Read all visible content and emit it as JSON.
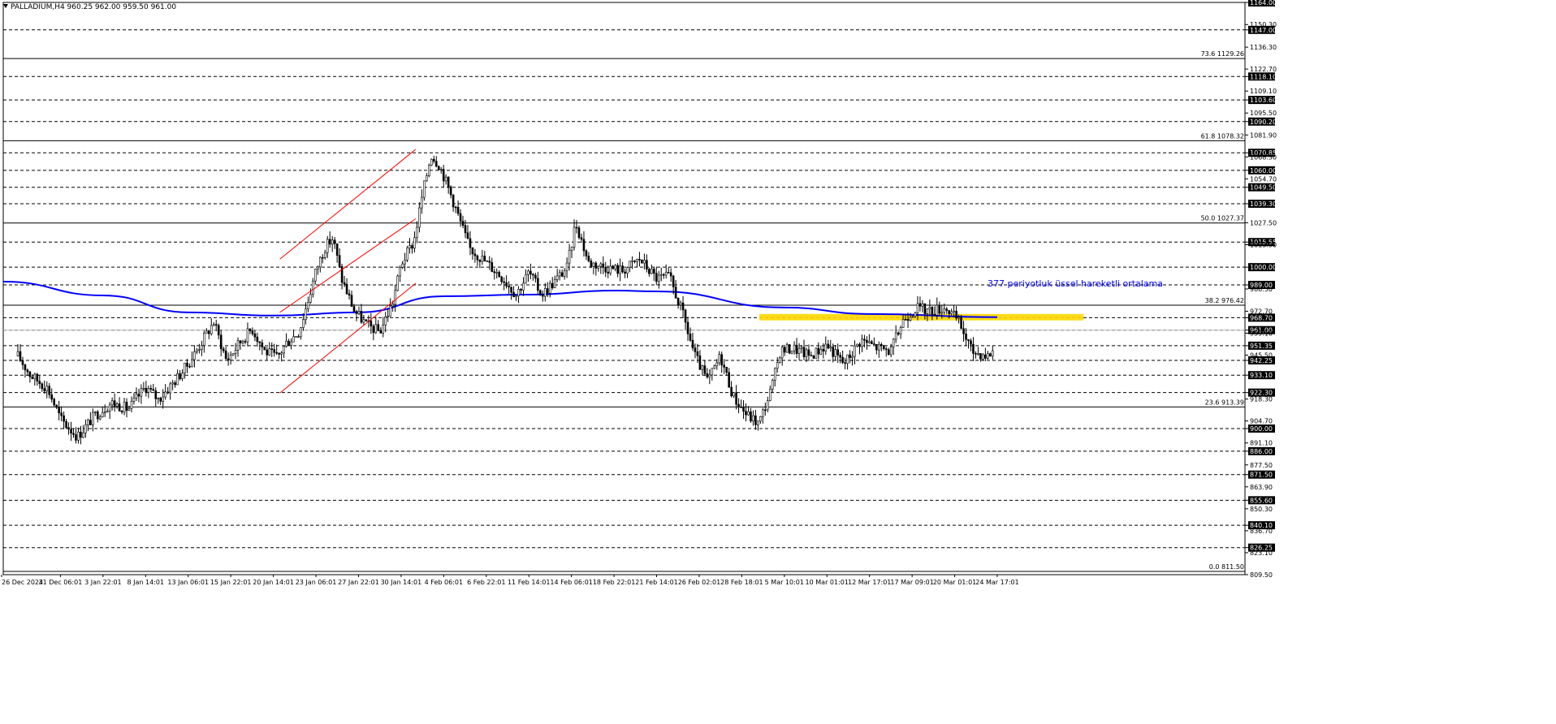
{
  "header": {
    "symbol_line": "PALLADIUM,H4  960.25 962.00 959.50 961.00"
  },
  "annotation": {
    "ema_label": "377 periyotluk üssel hareketli ortalama"
  },
  "colors": {
    "background": "#ffffff",
    "candle": "#000000",
    "ema": "#0000ff",
    "channel": "#ff0000",
    "zone": "#ffd700",
    "grid": "#000000"
  },
  "chart_data": {
    "type": "candlestick",
    "title": "PALLADIUM,H4",
    "ylim": [
      809.5,
      1164.0
    ],
    "x_ticks": [
      "26 Dec 2024",
      "31 Dec 06:01",
      "3 Jan 22:01",
      "8 Jan 14:01",
      "13 Jan 06:01",
      "15 Jan 22:01",
      "20 Jan 14:01",
      "23 Jan 06:01",
      "27 Jan 22:01",
      "30 Jan 14:01",
      "4 Feb 06:01",
      "6 Feb 22:01",
      "11 Feb 14:01",
      "14 Feb 06:01",
      "18 Feb 22:01",
      "21 Feb 14:01",
      "26 Feb 02:01",
      "28 Feb 18:01",
      "5 Mar 10:01",
      "10 Mar 01:01",
      "12 Mar 17:01",
      "17 Mar 09:01",
      "20 Mar 01:01",
      "24 Mar 17:01"
    ],
    "y_ticks": [
      1164.0,
      1150.3,
      1147.0,
      1136.3,
      1122.7,
      1118.1,
      1109.1,
      1103.6,
      1095.5,
      1090.2,
      1081.9,
      1070.85,
      1068.3,
      1060.0,
      1054.7,
      1049.5,
      1039.3,
      1027.5,
      1015.55,
      1013.9,
      1000.0,
      986.5,
      989.0,
      972.7,
      968.7,
      961.0,
      959.1,
      951.35,
      945.5,
      942.25,
      933.1,
      922.3,
      918.3,
      904.7,
      900.0,
      891.1,
      886.0,
      877.5,
      871.5,
      863.9,
      855.6,
      850.3,
      840.1,
      836.7,
      826.25,
      823.1,
      809.5
    ],
    "support_resistance_levels": [
      1147.0,
      1118.1,
      1103.6,
      1090.2,
      1070.85,
      1060.0,
      1049.5,
      1039.3,
      1015.55,
      1000.0,
      989.0,
      968.7,
      961.0,
      951.35,
      942.25,
      933.1,
      922.3,
      900.0,
      886.0,
      871.5,
      855.6,
      840.1,
      826.25
    ],
    "fibonacci_levels": [
      {
        "label": "73.6 1129.26",
        "value": 1129.26
      },
      {
        "label": "61.8 1078.32",
        "value": 1078.32
      },
      {
        "label": "50.0 1027.37",
        "value": 1027.37
      },
      {
        "label": "38.2 976.42",
        "value": 976.42
      },
      {
        "label": "23.6 913.39",
        "value": 913.39
      },
      {
        "label": "0.0 811.50",
        "value": 811.5
      }
    ],
    "last_price": 961.0,
    "ema_377": [
      {
        "x": "26 Dec 2024",
        "y": 991.0
      },
      {
        "x": "3 Jan 22:01",
        "y": 982.5
      },
      {
        "x": "13 Jan 06:01",
        "y": 972.0
      },
      {
        "x": "20 Jan 14:01",
        "y": 970.0
      },
      {
        "x": "27 Jan 22:01",
        "y": 972.0
      },
      {
        "x": "4 Feb 06:01",
        "y": 982.0
      },
      {
        "x": "11 Feb 14:01",
        "y": 983.0
      },
      {
        "x": "18 Feb 22:01",
        "y": 985.5
      },
      {
        "x": "21 Feb 14:01",
        "y": 985.0
      },
      {
        "x": "5 Mar 10:01",
        "y": 975.0
      },
      {
        "x": "12 Mar 17:01",
        "y": 971.0
      },
      {
        "x": "24 Mar 17:01",
        "y": 969.0
      }
    ],
    "resistance_zone": {
      "from": "3 Mar",
      "to": "27 Mar",
      "low": 967.0,
      "high": 971.0
    },
    "price_path": [
      [
        0,
        945
      ],
      [
        0.3,
        933
      ],
      [
        0.7,
        925
      ],
      [
        1.0,
        906
      ],
      [
        1.4,
        895
      ],
      [
        1.8,
        908
      ],
      [
        2.2,
        916
      ],
      [
        2.6,
        912
      ],
      [
        3.0,
        926
      ],
      [
        3.3,
        918
      ],
      [
        3.7,
        930
      ],
      [
        4.0,
        940
      ],
      [
        4.3,
        953
      ],
      [
        4.6,
        966
      ],
      [
        4.9,
        942
      ],
      [
        5.2,
        953
      ],
      [
        5.5,
        962
      ],
      [
        5.8,
        948
      ],
      [
        6.1,
        944
      ],
      [
        6.3,
        953
      ],
      [
        6.6,
        960
      ],
      [
        6.8,
        978
      ],
      [
        7.0,
        998
      ],
      [
        7.2,
        1012
      ],
      [
        7.4,
        1018
      ],
      [
        7.6,
        993
      ],
      [
        7.9,
        973
      ],
      [
        8.2,
        964
      ],
      [
        8.5,
        960
      ],
      [
        8.8,
        978
      ],
      [
        9.0,
        1002
      ],
      [
        9.3,
        1016
      ],
      [
        9.5,
        1045
      ],
      [
        9.7,
        1070
      ],
      [
        9.9,
        1063
      ],
      [
        10.1,
        1050
      ],
      [
        10.3,
        1035
      ],
      [
        10.6,
        1012
      ],
      [
        11.0,
        1003
      ],
      [
        11.4,
        993
      ],
      [
        11.7,
        983
      ],
      [
        12.0,
        997
      ],
      [
        12.3,
        983
      ],
      [
        12.6,
        991
      ],
      [
        12.9,
        1000
      ],
      [
        13.1,
        1028
      ],
      [
        13.4,
        1003
      ],
      [
        13.8,
        1000
      ],
      [
        14.2,
        998
      ],
      [
        14.6,
        1005
      ],
      [
        15.0,
        993
      ],
      [
        15.3,
        994
      ],
      [
        15.6,
        972
      ],
      [
        15.9,
        945
      ],
      [
        16.2,
        929
      ],
      [
        16.5,
        945
      ],
      [
        16.8,
        920
      ],
      [
        17.1,
        909
      ],
      [
        17.4,
        903
      ],
      [
        17.7,
        925
      ],
      [
        17.9,
        948
      ],
      [
        18.2,
        950
      ],
      [
        18.6,
        945
      ],
      [
        19.0,
        952
      ],
      [
        19.4,
        940
      ],
      [
        19.8,
        955
      ],
      [
        20.2,
        950
      ],
      [
        20.5,
        948
      ],
      [
        20.8,
        968
      ],
      [
        21.1,
        975
      ],
      [
        21.4,
        973
      ],
      [
        21.8,
        975
      ],
      [
        22.1,
        966
      ],
      [
        22.4,
        948
      ],
      [
        22.8,
        945
      ],
      [
        23.1,
        957
      ],
      [
        23.4,
        968
      ],
      [
        23.6,
        957
      ],
      [
        23.8,
        961
      ]
    ],
    "channel_lines": [
      {
        "from": [
          "20 Jan 14:01",
          1005
        ],
        "to": [
          "30 Jan 14:01",
          1073
        ]
      },
      {
        "from": [
          "20 Jan 14:01",
          972
        ],
        "to": [
          "30 Jan 14:01",
          1030
        ]
      },
      {
        "from": [
          "20 Jan 14:01",
          922
        ],
        "to": [
          "30 Jan 14:01",
          990
        ]
      }
    ]
  }
}
